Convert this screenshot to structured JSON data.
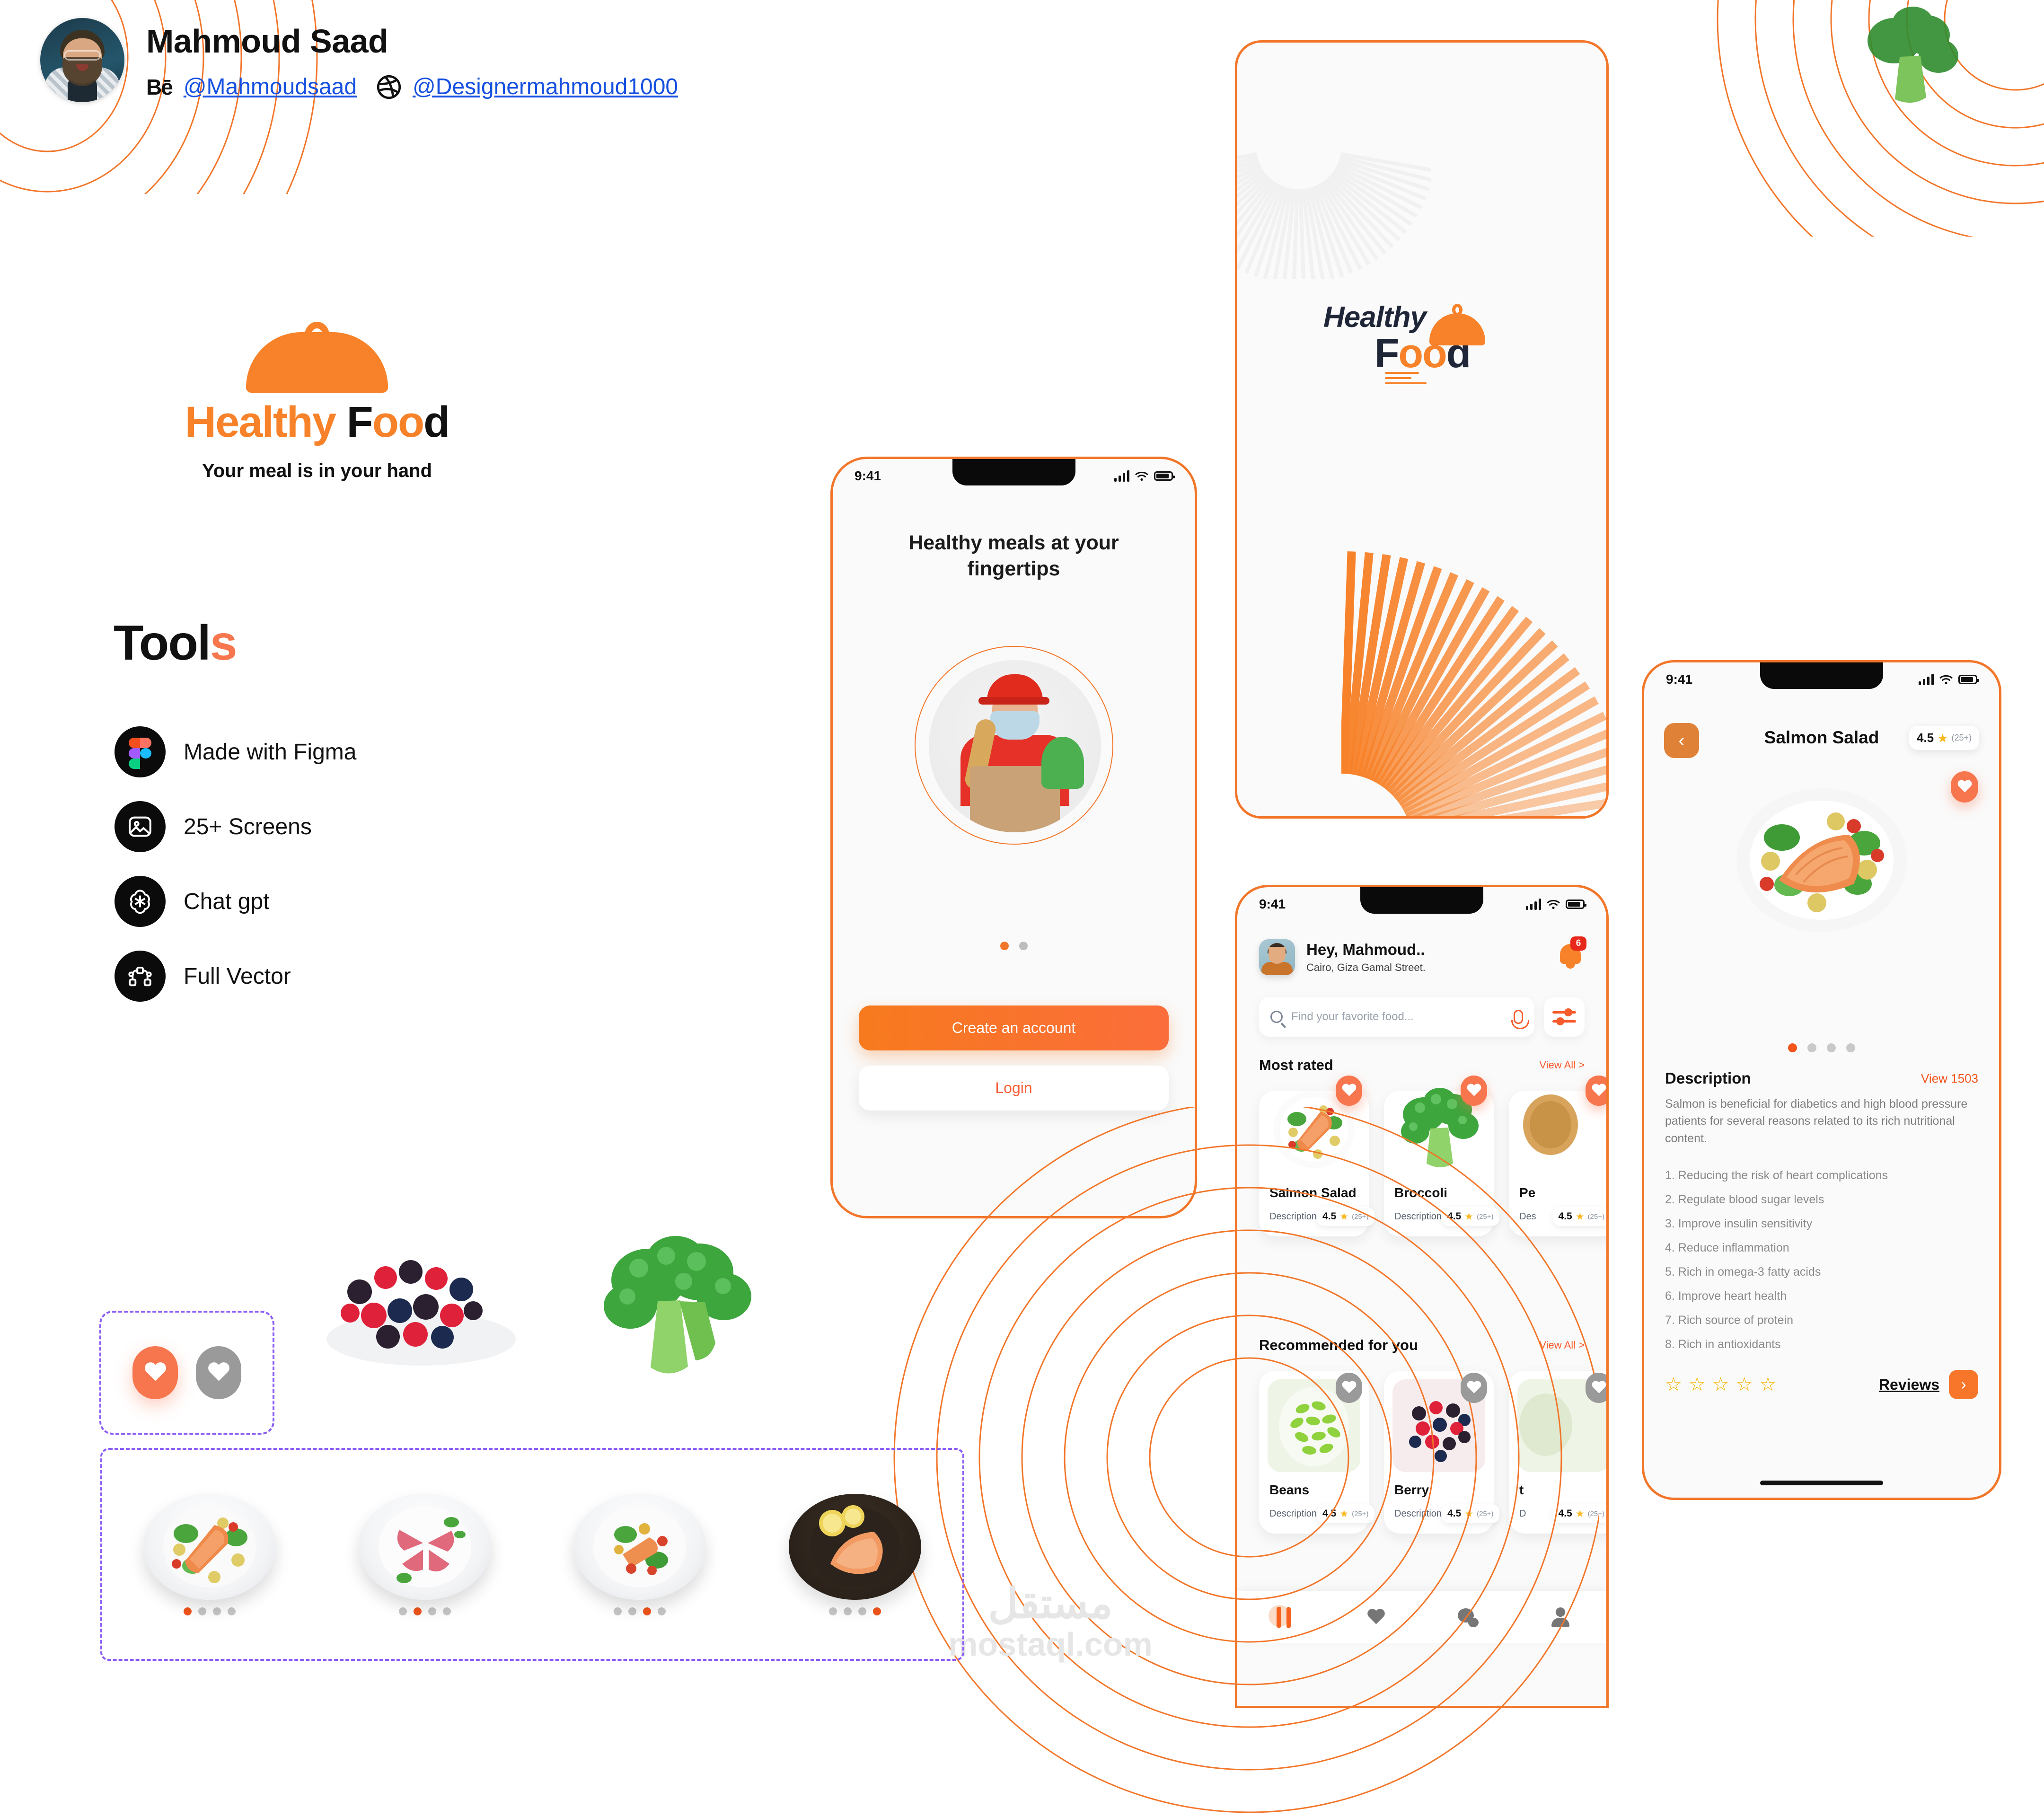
{
  "author": {
    "name": "Mahmoud Saad",
    "behance_mark": "Bē",
    "behance_handle": "@Mahmoudsaad",
    "dribbble_handle": "@Designermahmoud1000"
  },
  "brand": {
    "logo_part_1": "Healthy",
    "logo_part_2_f": "F",
    "logo_part_2_oo": "oo",
    "logo_part_2_d": "d",
    "tagline": "Your meal is in your hand",
    "accent_color": "#F7822A",
    "accent_alt": "#F2541B"
  },
  "tools": {
    "title_main": "Tool",
    "title_accent": "s",
    "items": [
      {
        "label": "Made with Figma",
        "icon": "figma-icon"
      },
      {
        "label": "25+ Screens",
        "icon": "image-icon"
      },
      {
        "label": "Chat gpt",
        "icon": "openai-icon"
      },
      {
        "label": "Full Vector",
        "icon": "vector-node-icon"
      }
    ]
  },
  "onboarding": {
    "status_time": "9:41",
    "headline": "Healthy meals at your fingertips",
    "primary_button": "Create an account",
    "secondary_button": "Login",
    "dots": 2,
    "active_dot": 0
  },
  "splash": {
    "logo_top": "Healthy",
    "logo_f": "F",
    "logo_oo": "oo",
    "logo_d": "d"
  },
  "home": {
    "status_time": "9:41",
    "greeting": "Hey, Mahmoud..",
    "address": "Cairo, Giza Gamal Street.",
    "notification_count": "6",
    "search_placeholder": "Find your favorite food...",
    "sections": [
      {
        "title": "Most rated",
        "view_all": "View All >",
        "cards": [
          {
            "name": "Salmon Salad",
            "desc": "Description",
            "rating": "4.5",
            "count": "(25+)",
            "fav": true
          },
          {
            "name": "Broccoli",
            "desc": "Description",
            "rating": "4.5",
            "count": "(25+)",
            "fav": true
          },
          {
            "name": "Pe",
            "desc": "Des",
            "rating": "4.5",
            "count": "(25+)",
            "fav": true
          }
        ]
      },
      {
        "title": "Recommended for you",
        "view_all": "View All >",
        "cards": [
          {
            "name": "Beans",
            "desc": "Description",
            "rating": "4.5",
            "count": "(25+)",
            "fav": false
          },
          {
            "name": "Berry",
            "desc": "Description",
            "rating": "4.5",
            "count": "(25+)",
            "fav": false
          },
          {
            "name": "t",
            "desc": "D",
            "rating": "4.5",
            "count": "(25+)",
            "fav": false
          }
        ]
      }
    ],
    "tabs": [
      {
        "name": "meals-tab",
        "icon": "cutlery-icon",
        "active": true
      },
      {
        "name": "favorites-tab",
        "icon": "heart-icon",
        "active": false
      },
      {
        "name": "chat-tab",
        "icon": "chat-bubble-icon",
        "active": false
      },
      {
        "name": "profile-tab",
        "icon": "person-icon",
        "active": false
      }
    ]
  },
  "detail": {
    "status_time": "9:41",
    "back_icon": "chevron-left-icon",
    "title": "Salmon Salad",
    "rating": "4.5",
    "rating_count": "(25+)",
    "carousel_dots": 4,
    "carousel_active": 0,
    "description_label": "Description",
    "views": "View 1503",
    "intro": "Salmon is beneficial for diabetics and high blood pressure patients for several reasons related to its rich nutritional content.",
    "benefits": [
      "1. Reducing the risk of heart complications",
      "2. Regulate blood sugar levels",
      "3. Improve insulin sensitivity",
      "4. Reduce inflammation",
      "5. Rich in omega-3 fatty acids",
      "6. Improve heart health",
      "7. Rich source of protein",
      "8. Rich in antioxidants"
    ],
    "stars": 5,
    "reviews_label": "Reviews",
    "reviews_arrow": "chevron-right-icon"
  },
  "components": {
    "heart_states": [
      "active",
      "inactive"
    ],
    "plates": [
      {
        "name": "salmon-salad-plate",
        "active_dot": 0
      },
      {
        "name": "tuna-plate",
        "active_dot": 1
      },
      {
        "name": "mixed-salad-plate",
        "active_dot": 2
      },
      {
        "name": "salmon-fillet-plate",
        "active_dot": 3
      }
    ],
    "dots_per_plate": 4
  },
  "watermark": {
    "arabic": "مستقل",
    "latin": "mostaql.com"
  }
}
